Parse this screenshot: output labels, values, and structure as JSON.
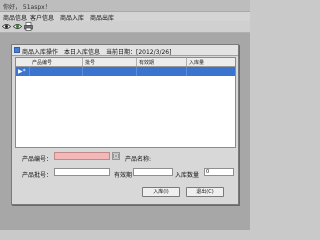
{
  "window": {
    "title": "你好， 51aspx！"
  },
  "menu": {
    "items": [
      "商品信息",
      "客户信息",
      "商品入库",
      "商品出库"
    ]
  },
  "toolbar": {
    "icons": [
      "eye-icon",
      "eye-check-icon",
      "printer-icon"
    ]
  },
  "dialog": {
    "title": "商品入库操作　本日入库信息　当前日期：[2012/3/26]",
    "grid": {
      "columns": [
        "产品编号",
        "批号",
        "有效期",
        "入库量"
      ],
      "rows": [
        {
          "marker": "▶*"
        }
      ]
    },
    "form": {
      "product_code_label": "产品编号：",
      "product_code_value": "",
      "product_name_label": "产品名称:",
      "product_name_value": "",
      "batch_label": "产品批号：",
      "batch_value": "",
      "expiry_label": "有效期",
      "expiry_value": "",
      "quantity_label": "入库数量",
      "quantity_value": "0"
    },
    "buttons": {
      "stock_in": "入库(I)",
      "exit": "退出(C)"
    }
  }
}
